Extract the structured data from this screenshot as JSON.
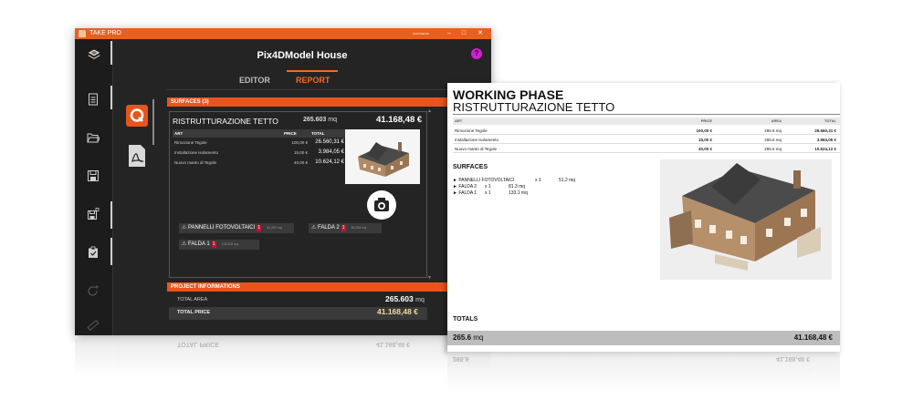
{
  "window": {
    "title": "TAKE PRO",
    "user": "username"
  },
  "app": {
    "project_title": "Pix4DModel House",
    "help_label": "?",
    "tabs": [
      {
        "label": "EDITOR",
        "active": false
      },
      {
        "label": "REPORT",
        "active": true
      }
    ]
  },
  "sidebar": {
    "items": [
      {
        "icon": "layers-logo-icon"
      },
      {
        "icon": "document-icon"
      },
      {
        "icon": "folder-open-icon"
      },
      {
        "icon": "save-icon"
      },
      {
        "icon": "save-as-icon"
      },
      {
        "icon": "clipboard-icon"
      },
      {
        "icon": "refresh-add-icon"
      },
      {
        "icon": "ruler-icon"
      }
    ]
  },
  "surfaces": {
    "header": "SURFACES (3)",
    "item": {
      "title": "RISTRUTTURAZIONE TETTO",
      "quantity": "265.603",
      "unit": "mq",
      "total": "41.168,48 €"
    },
    "table": {
      "headers": {
        "art": "ART",
        "price": "PRICE",
        "total": "TOTAL"
      },
      "rows": [
        {
          "art": "Rimozione Tegole",
          "price": "100,00 €",
          "total": "26.560,31 €"
        },
        {
          "art": "Installazione isolamento",
          "price": "15,00 €",
          "total": "3.984,05 €"
        },
        {
          "art": "Nuovo manto di Tegole",
          "price": "40,00 €",
          "total": "10.624,12 €"
        }
      ]
    },
    "chips": [
      {
        "label": "PANNELLI FOTOVOLTAICI",
        "count": "1",
        "area": "51.237 mq"
      },
      {
        "label": "FALDA 2",
        "count": "1",
        "area": "81.264 mq"
      },
      {
        "label": "FALDA 1",
        "count": "1",
        "area": "133.102 mq"
      }
    ]
  },
  "project_info": {
    "header": "PROJECT INFORMATIONS",
    "total_area_label": "TOTAL AREA",
    "total_area_value": "265.603",
    "total_area_unit": "mq",
    "total_price_label": "TOTAL PRICE",
    "total_price_value": "41.168,48 €"
  },
  "report": {
    "title": "WORKING PHASE",
    "subtitle": "RISTRUTTURAZIONE TETTO",
    "headers": {
      "art": "ART",
      "price": "PRICE",
      "area": "AREA",
      "total": "TOTAL"
    },
    "rows": [
      {
        "art": "Rimozione Tegole",
        "price": "100,00 €",
        "area": "265.6 mq",
        "total": "26.560,31 €"
      },
      {
        "art": "Installazione isolamento",
        "price": "15,00 €",
        "area": "265.6 mq",
        "total": "3.984,05 €"
      },
      {
        "art": "Nuovo manto di Tegole",
        "price": "40,00 €",
        "area": "265.6 mq",
        "total": "10.624,12 €"
      }
    ],
    "surfaces_title": "SURFACES",
    "surfaces": [
      {
        "name": "► PANNELLI FOTOVOLTAICI",
        "qty": "x 1",
        "area": "51.2 mq"
      },
      {
        "name": "► FALDA 2",
        "qty": "x 1",
        "area": "81.3 mq"
      },
      {
        "name": "► FALDA 1",
        "qty": "x 1",
        "area": "133.1 mq"
      }
    ],
    "totals_title": "TOTALS",
    "totals_area": "265.6",
    "totals_unit": "mq",
    "totals_price": "41.168,48 €"
  },
  "colors": {
    "accent": "#e8541b",
    "titlebar": "#e8601c",
    "help": "#d11fd6",
    "app_bg": "#242424"
  }
}
